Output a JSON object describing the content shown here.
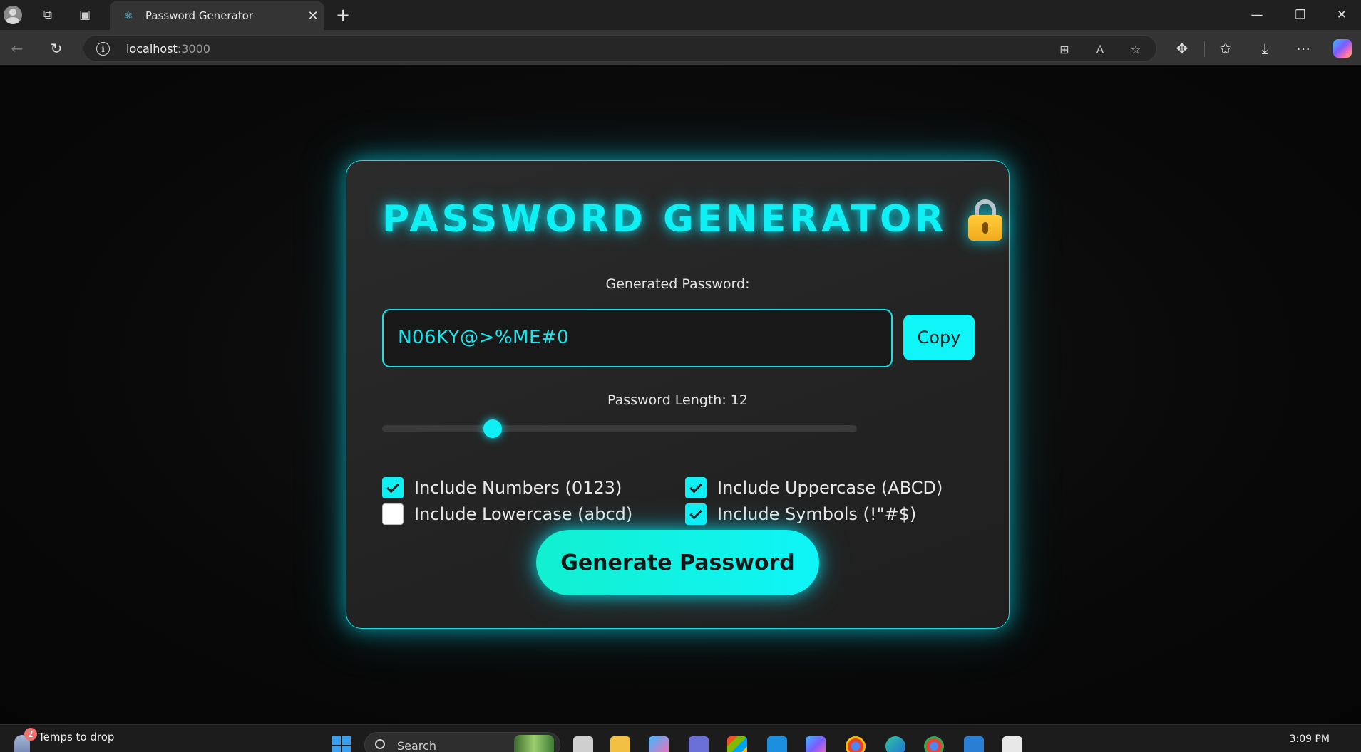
{
  "browser": {
    "tab_title": "Password Generator",
    "new_tab_icon": "+",
    "close_icon": "✕",
    "url_host": "localhost",
    "url_port": ":3000"
  },
  "app": {
    "title": "PASSWORD GENERATOR",
    "generated_label": "Generated Password:",
    "password": "N06KY@>%ME#0",
    "copy_label": "Copy",
    "length_label": "Password Length: 12",
    "slider_fraction": 0.233,
    "options": [
      {
        "label": "Include Numbers (0123)",
        "checked": true
      },
      {
        "label": "Include Uppercase (ABCD)",
        "checked": true
      },
      {
        "label": "Include Lowercase (abcd)",
        "checked": false
      },
      {
        "label": "Include Symbols (!\"#$)",
        "checked": true
      }
    ],
    "generate_label": "Generate Password"
  },
  "taskbar": {
    "weather_badge": "2",
    "weather_text": "Temps to drop",
    "search_placeholder": "Search",
    "time": "3:09 PM"
  },
  "colors": {
    "accent": "#0ff0f5",
    "card_bg": "#262626",
    "page_bg": "#0a0a0a"
  }
}
